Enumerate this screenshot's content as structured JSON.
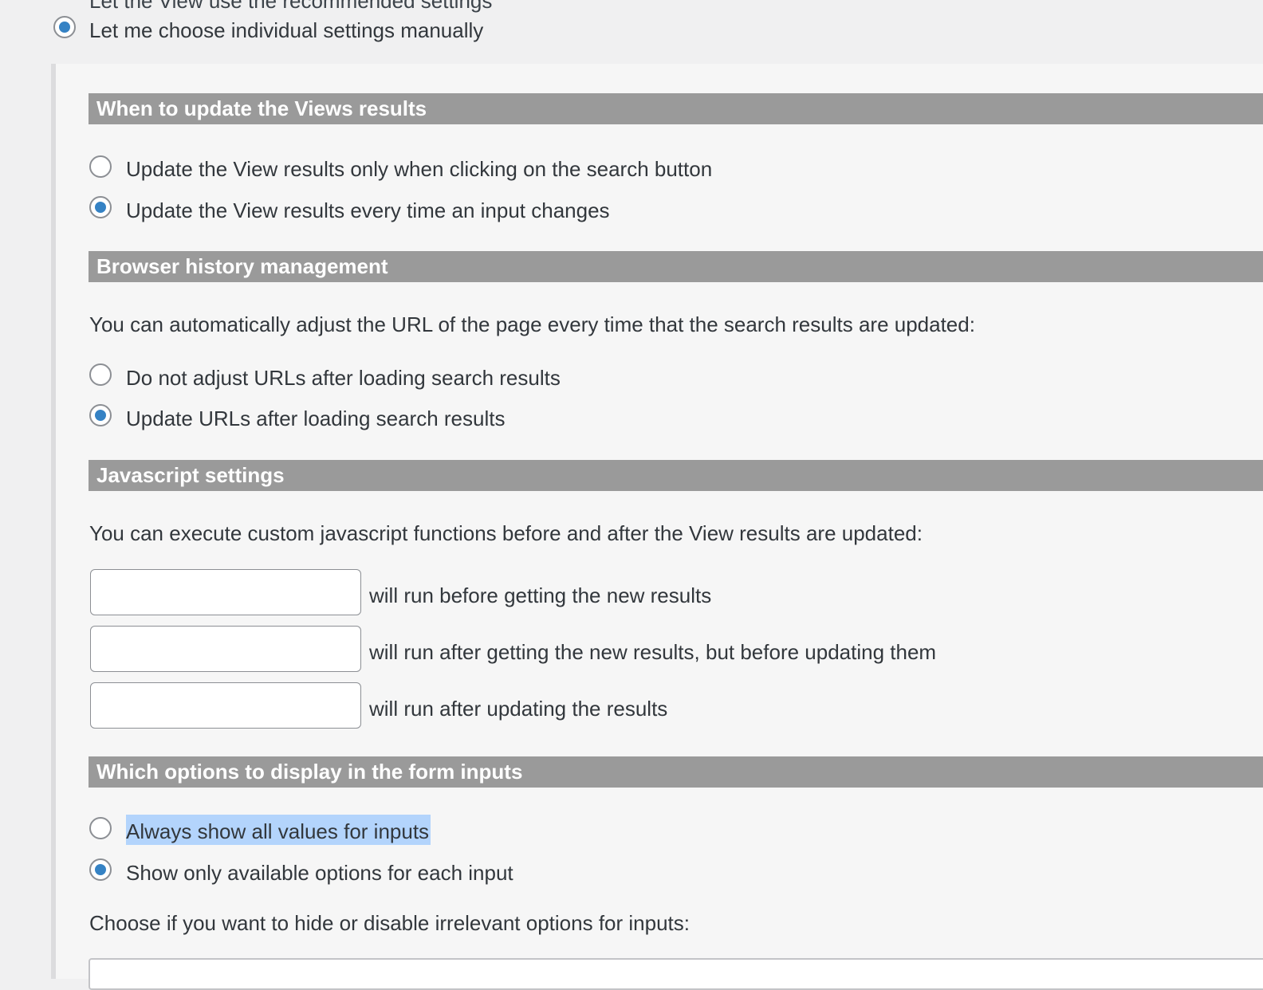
{
  "top_option_partial": "Let the View use the recommended settings",
  "manual_option": {
    "label": "Let me choose individual settings manually",
    "checked": true
  },
  "sections": {
    "update": {
      "title": "When to update the Views results",
      "options": [
        {
          "label": "Update the View results only when clicking on the search button",
          "checked": false
        },
        {
          "label": "Update the View results every time an input changes",
          "checked": true
        }
      ]
    },
    "history": {
      "title": "Browser history management",
      "description": "You can automatically adjust the URL of the page every time that the search results are updated:",
      "options": [
        {
          "label": "Do not adjust URLs after loading search results",
          "checked": false
        },
        {
          "label": "Update URLs after loading search results",
          "checked": true
        }
      ]
    },
    "javascript": {
      "title": "Javascript settings",
      "description": "You can execute custom javascript functions before and after the View results are updated:",
      "fields": [
        {
          "value": "",
          "label": "will run before getting the new results"
        },
        {
          "value": "",
          "label": "will run after getting the new results, but before updating them"
        },
        {
          "value": "",
          "label": "will run after updating the results"
        }
      ]
    },
    "options_display": {
      "title": "Which options to display in the form inputs",
      "options": [
        {
          "label": "Always show all values for inputs",
          "checked": false,
          "selected_text": true
        },
        {
          "label": "Show only available options for each input",
          "checked": true
        }
      ],
      "description": "Choose if you want to hide or disable irrelevant options for inputs:"
    }
  },
  "colors": {
    "accent": "#3582c4",
    "section_header_bg": "#9a9a9a",
    "selection_highlight": "#b3d4fc"
  }
}
